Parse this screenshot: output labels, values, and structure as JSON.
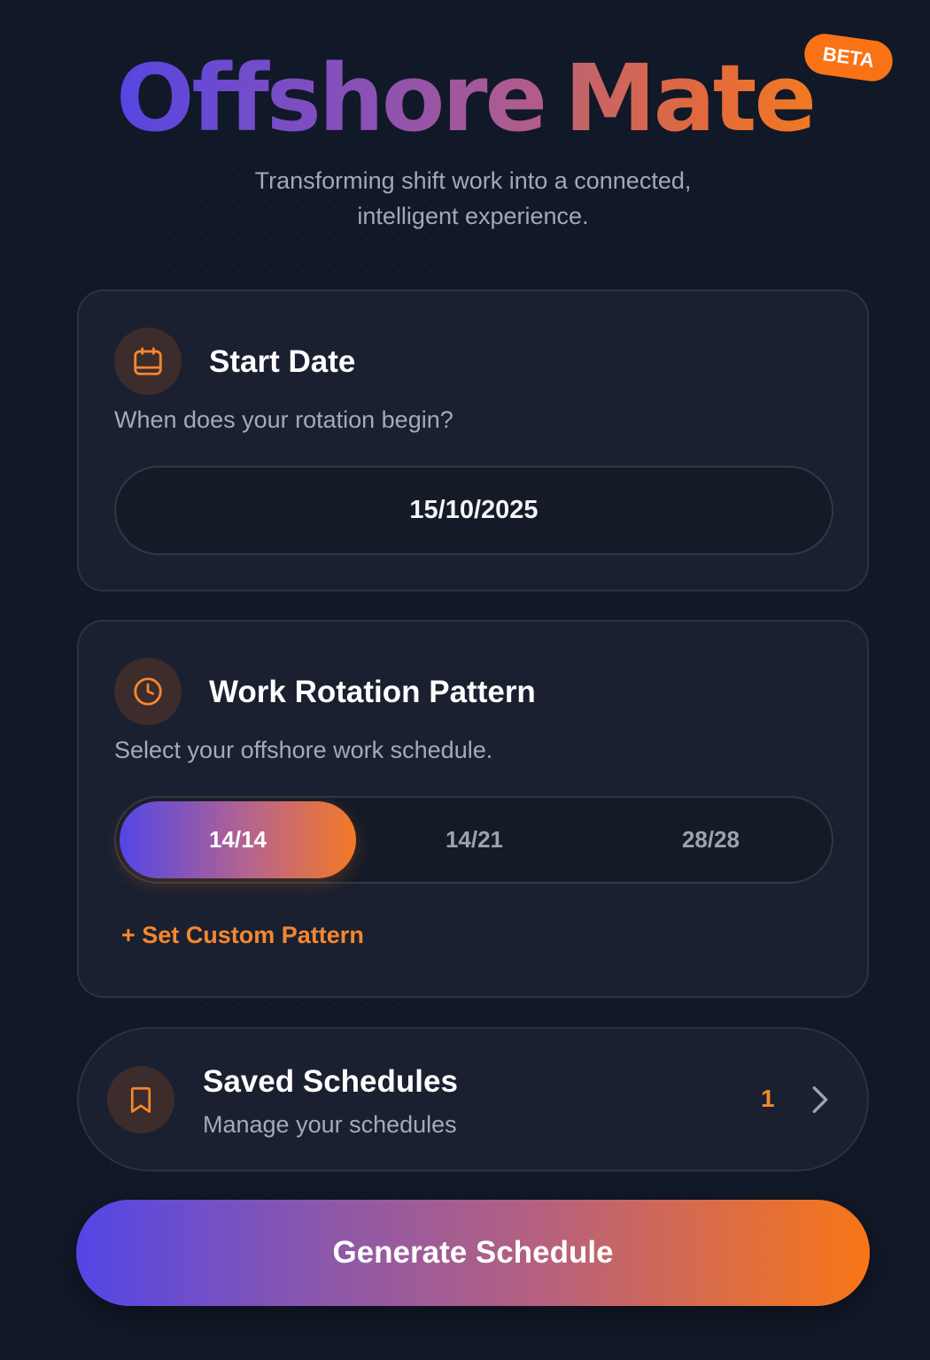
{
  "app": {
    "title_part1": "Offshore",
    "title_part2": "Mate",
    "badge": "BETA",
    "tagline_line1": "Transforming shift work into a connected,",
    "tagline_line2": "intelligent experience."
  },
  "start_date": {
    "icon": "calendar-icon",
    "title": "Start Date",
    "subtitle": "When does your rotation begin?",
    "value": "15/10/2025"
  },
  "rotation": {
    "icon": "clock-icon",
    "title": "Work Rotation Pattern",
    "subtitle": "Select your offshore work schedule.",
    "options": [
      "14/14",
      "14/21",
      "28/28"
    ],
    "selected": "14/14",
    "custom_link": "+ Set Custom Pattern"
  },
  "saved": {
    "icon": "bookmark-icon",
    "title": "Saved Schedules",
    "subtitle": "Manage your schedules",
    "count": "1"
  },
  "generate_label": "Generate Schedule",
  "colors": {
    "background": "#111827",
    "card": "#1a2030",
    "accent_orange": "#f97316",
    "accent_purple": "#5346e6"
  }
}
